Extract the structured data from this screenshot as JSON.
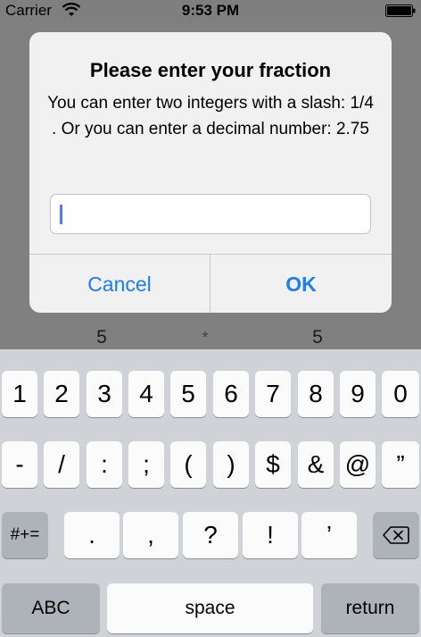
{
  "status_bar": {
    "carrier": "Carrier",
    "time": "9:53 PM"
  },
  "background": {
    "fraction_left_denominator": "5",
    "operator": "*",
    "fraction_right_denominator": "5"
  },
  "alert": {
    "title": "Please enter your fraction",
    "message": "You can enter two integers with a slash: 1/4 . Or you can enter a decimal number: 2.75",
    "input_value": "",
    "cancel_label": "Cancel",
    "ok_label": "OK",
    "button_color": "#1b7cf4"
  },
  "keyboard": {
    "row1": [
      "1",
      "2",
      "3",
      "4",
      "5",
      "6",
      "7",
      "8",
      "9",
      "0"
    ],
    "row2": [
      "-",
      "/",
      ":",
      ";",
      "(",
      ")",
      "$",
      "&",
      "@",
      "”"
    ],
    "row3_mode": "#+=",
    "row3": [
      ".",
      ",",
      "?",
      "!",
      "’"
    ],
    "backspace_icon": "backspace-icon",
    "abc_label": "ABC",
    "space_label": "space",
    "return_label": "return"
  }
}
